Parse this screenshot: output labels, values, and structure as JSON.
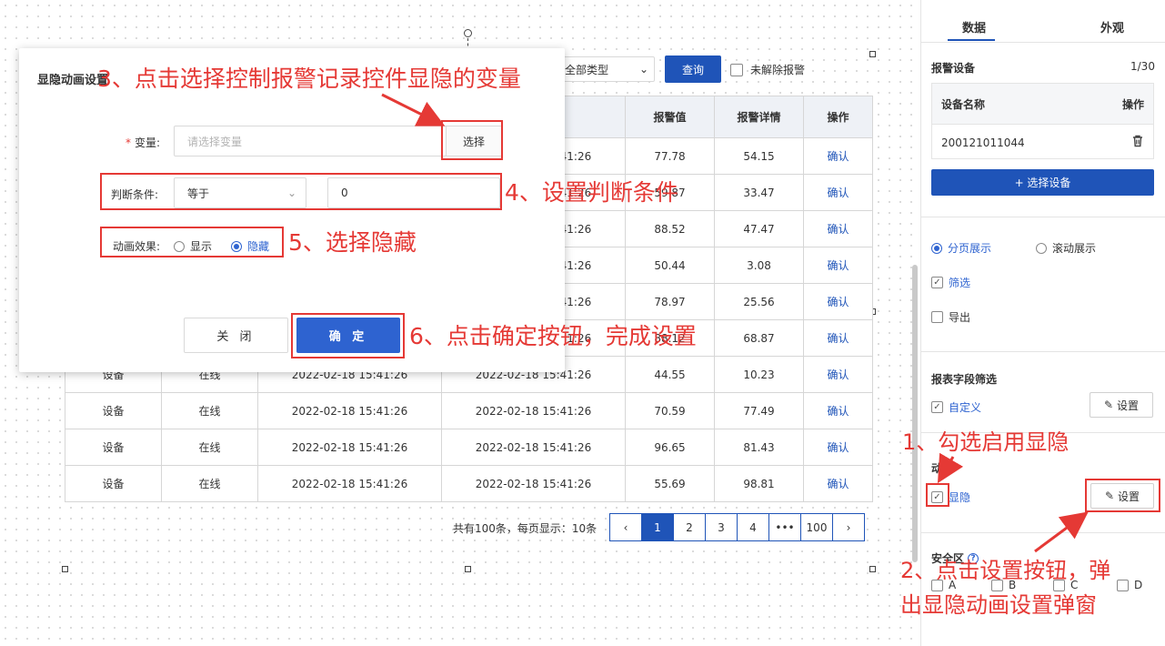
{
  "toolbar": {
    "type_select": "全部类型",
    "query_button": "查询",
    "unresolved_label": "未解除报警"
  },
  "table": {
    "headers_visible": [
      "",
      "",
      "",
      "",
      "报警值",
      "报警详情",
      "操作"
    ],
    "rows": [
      {
        "c0": "",
        "c1": "",
        "c2": "",
        "time": "2022-02-18 15:41:26",
        "value": "77.78",
        "detail": "54.15",
        "op": "确认"
      },
      {
        "c0": "",
        "c1": "",
        "c2": "",
        "time": "2022-02-18 15:41:26",
        "value": "59.87",
        "detail": "33.47",
        "op": "确认"
      },
      {
        "c0": "",
        "c1": "",
        "c2": "",
        "time": "2022-02-18 15:41:26",
        "value": "88.52",
        "detail": "47.47",
        "op": "确认"
      },
      {
        "c0": "",
        "c1": "",
        "c2": "",
        "time": "2022-02-18 15:41:26",
        "value": "50.44",
        "detail": "3.08",
        "op": "确认"
      },
      {
        "c0": "",
        "c1": "",
        "c2": "",
        "time": "2022-02-18 15:41:26",
        "value": "78.97",
        "detail": "25.56",
        "op": "确认"
      },
      {
        "c0": "",
        "c1": "",
        "c2": "",
        "time": "2022-02-18 15:41:26",
        "value": "88.12",
        "detail": "68.87",
        "op": "确认"
      },
      {
        "c0": "设备",
        "c1": "在线",
        "c2": "2022-02-18 15:41:26",
        "time": "2022-02-18 15:41:26",
        "value": "44.55",
        "detail": "10.23",
        "op": "确认"
      },
      {
        "c0": "设备",
        "c1": "在线",
        "c2": "2022-02-18 15:41:26",
        "time": "2022-02-18 15:41:26",
        "value": "70.59",
        "detail": "77.49",
        "op": "确认"
      },
      {
        "c0": "设备",
        "c1": "在线",
        "c2": "2022-02-18 15:41:26",
        "time": "2022-02-18 15:41:26",
        "value": "96.65",
        "detail": "81.43",
        "op": "确认"
      },
      {
        "c0": "设备",
        "c1": "在线",
        "c2": "2022-02-18 15:41:26",
        "time": "2022-02-18 15:41:26",
        "value": "55.69",
        "detail": "98.81",
        "op": "确认"
      }
    ]
  },
  "pagination": {
    "info": "共有100条，每页显示：10条",
    "prev": "‹",
    "pages": [
      "1",
      "2",
      "3",
      "4",
      "•••",
      "100"
    ],
    "next": "›",
    "active": "1"
  },
  "panel": {
    "tabs": [
      "数据",
      "外观"
    ],
    "alarm_device_title": "报警设备",
    "alarm_device_count": "1/30",
    "device_table_header_name": "设备名称",
    "device_table_header_op": "操作",
    "device_id": "200121011044",
    "select_device_button": "+ 选择设备",
    "paging_option": "分页展示",
    "scroll_option": "滚动展示",
    "filter_label": "筛选",
    "export_label": "导出",
    "report_field_title": "报表字段筛选",
    "custom_label": "自定义",
    "setting_label": "设置",
    "animation_title": "动画",
    "visibility_label": "显隐",
    "safe_zone_title": "安全区",
    "safe_zones": [
      "A",
      "B",
      "C",
      "D"
    ]
  },
  "modal": {
    "title": "显隐动画设置",
    "variable_label": "变量:",
    "variable_placeholder": "请选择变量",
    "choose_button": "选择",
    "condition_label": "判断条件:",
    "condition_value": "等于",
    "condition_input": "0",
    "effect_label": "动画效果:",
    "effect_show": "显示",
    "effect_hide": "隐藏",
    "close_button": "关 闭",
    "ok_button": "确 定"
  },
  "annotations": {
    "step1": "1、勾选启用显隐",
    "step2_line1": "2、点击设置按钮，弹",
    "step2_line2": "出显隐动画设置弹窗",
    "step3": "3、点击选择控制报警记录控件显隐的变量",
    "step4": "4、设置判断条件",
    "step5": "5、选择隐藏",
    "step6": "6、点击确定按钮，完成设置",
    "color": "#e53935"
  }
}
